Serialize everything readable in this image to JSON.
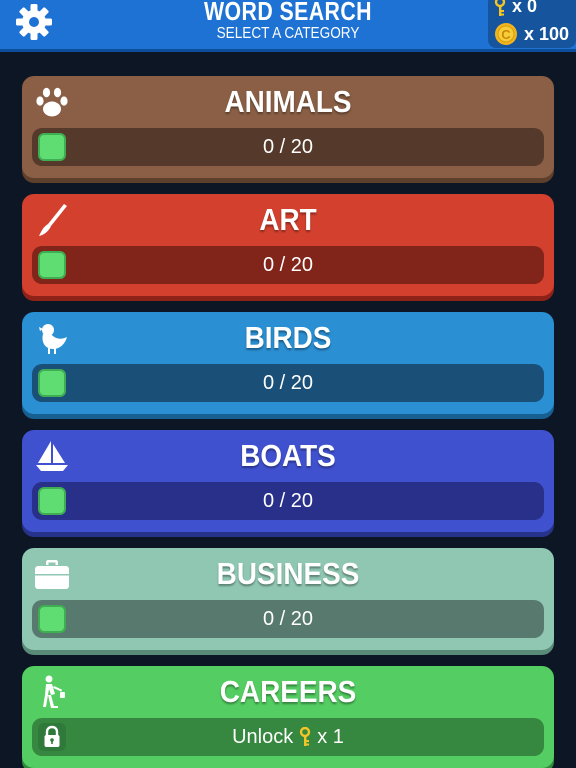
{
  "header": {
    "title": "WORD SEARCH",
    "subtitle": "SELECT A CATEGORY",
    "keys_count": "x 0",
    "coins_count": "x 100",
    "icons": [
      "gear-icon",
      "key-icon",
      "coin-icon"
    ]
  },
  "colors": {
    "header": "#1d72d4",
    "animals": "#8a5f45",
    "art": "#d3402e",
    "birds": "#2a8fd3",
    "boats": "#4051cf",
    "business": "#8fc7b3",
    "careers": "#54cd62",
    "progress_marker": "#5fdc72"
  },
  "categories": [
    {
      "name": "ANIMALS",
      "progress": "0 / 20",
      "icon": "paw-icon"
    },
    {
      "name": "ART",
      "progress": "0 / 20",
      "icon": "paintbrush-icon"
    },
    {
      "name": "BIRDS",
      "progress": "0 / 20",
      "icon": "bird-icon"
    },
    {
      "name": "BOATS",
      "progress": "0 / 20",
      "icon": "sailboat-icon"
    },
    {
      "name": "BUSINESS",
      "progress": "0 / 20",
      "icon": "briefcase-icon"
    },
    {
      "name": "CAREERS",
      "icon": "worker-icon",
      "locked": true,
      "unlock_label": "Unlock",
      "unlock_cost": "x 1"
    }
  ]
}
